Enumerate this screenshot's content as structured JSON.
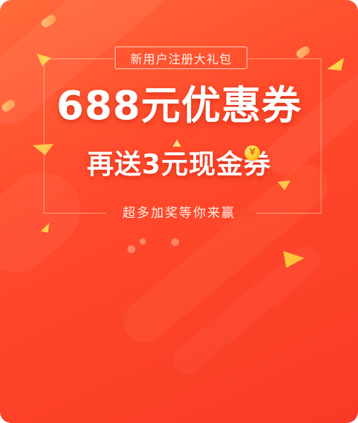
{
  "promo": {
    "badge_text": "新用户注册大礼包",
    "headline": "688元优惠券",
    "subheadline": "再送3元现金券",
    "footer_text": "超多加奖等你来赢",
    "coin_symbol": "¥"
  },
  "colors": {
    "background_top": "#ff6a3a",
    "background_bottom": "#f93a25",
    "accent_gold": "#ffc21a",
    "text": "#ffffff"
  }
}
